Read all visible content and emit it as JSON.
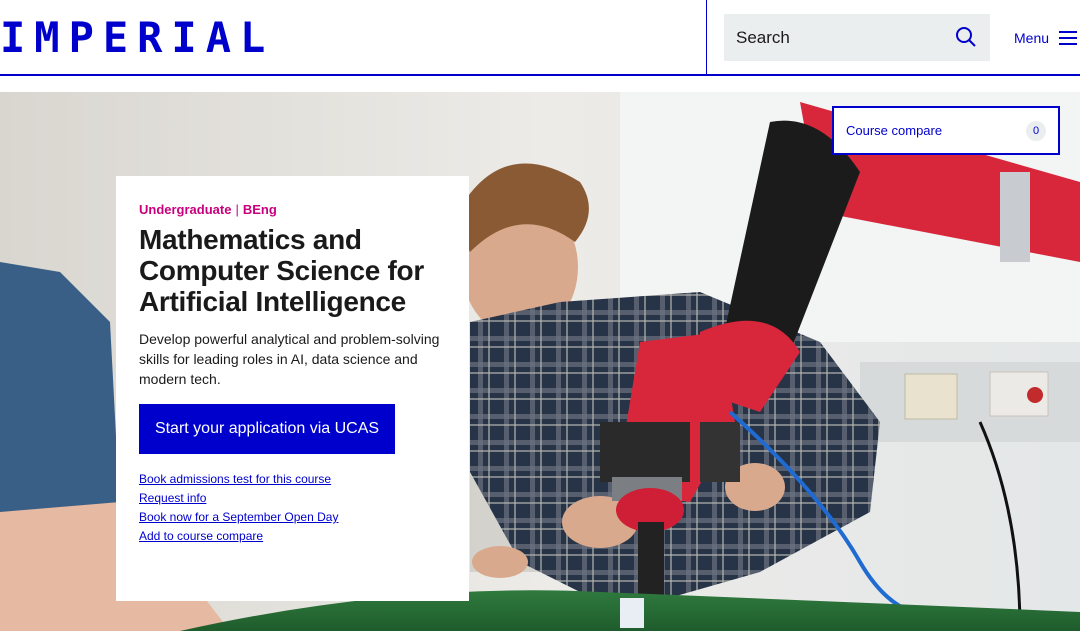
{
  "header": {
    "logo": "IMPERIAL",
    "search": {
      "label": "Search",
      "icon": "search-icon"
    },
    "menu": {
      "label": "Menu",
      "icon": "hamburger-icon"
    }
  },
  "compare": {
    "label": "Course compare",
    "count": "0"
  },
  "course": {
    "level": "Undergraduate",
    "degree": "BEng",
    "title": "Mathematics and Computer Science for Artificial Intelligence",
    "description": "Develop powerful analytical and problem-solving skills for leading roles in AI, data science and modern tech.",
    "cta_label": "Start your application via UCAS",
    "links": [
      "Book admissions test for this course",
      "Request info",
      "Book now for a September Open Day",
      "Add to course compare"
    ]
  },
  "colors": {
    "brand_blue": "#0000cd",
    "accent_magenta": "#c8007e",
    "search_bg": "#ebeeee"
  }
}
